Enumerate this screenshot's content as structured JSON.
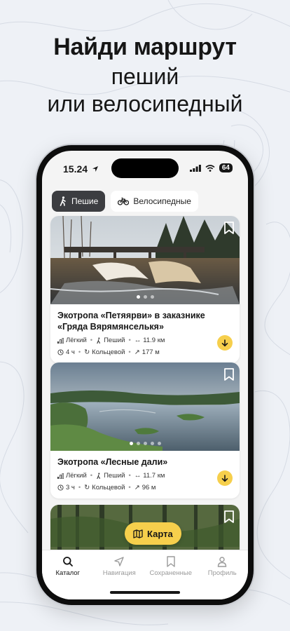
{
  "headline": {
    "line1": "Найди маршрут",
    "line2": "пеший",
    "line3": "или велосипедный"
  },
  "status": {
    "time": "15.24",
    "battery": "64"
  },
  "filters": [
    {
      "label": "Пешие",
      "icon": "walking-icon",
      "active": true
    },
    {
      "label": "Велосипедные",
      "icon": "bicycle-icon",
      "active": false
    }
  ],
  "routes": [
    {
      "title": "Экотропа «Петяярви» в заказнике «Гряда Вярямянселькя»",
      "difficulty": "Лёгкий",
      "mode": "Пеший",
      "distance": "11.9 км",
      "duration": "4 ч",
      "route_type": "Кольцевой",
      "elevation": "177 м",
      "photos_count": 3,
      "active_photo": 1
    },
    {
      "title": "Экотропа «Лесные дали»",
      "difficulty": "Лёгкий",
      "mode": "Пеший",
      "distance": "11.7 км",
      "duration": "3 ч",
      "route_type": "Кольцевой",
      "elevation": "96 м",
      "photos_count": 5,
      "active_photo": 1
    }
  ],
  "map_button": {
    "label": "Карта"
  },
  "tabs": [
    {
      "label": "Каталог",
      "icon": "search-icon",
      "active": true
    },
    {
      "label": "Навигация",
      "icon": "navigation-arrow-icon",
      "active": false
    },
    {
      "label": "Сохраненные",
      "icon": "bookmark-icon",
      "active": false
    },
    {
      "label": "Профиль",
      "icon": "profile-icon",
      "active": false
    }
  ],
  "colors": {
    "accent": "#f6cf4c",
    "active_chip": "#3c3d41",
    "background": "#eef1f6"
  }
}
